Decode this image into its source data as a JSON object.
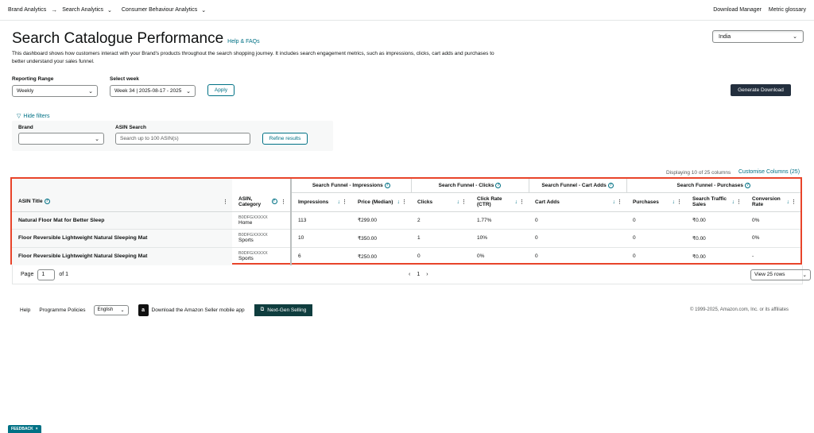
{
  "breadcrumbs": [
    "Brand Analytics",
    "Search Analytics",
    "Consumer Behaviour Analytics"
  ],
  "topnav_right": [
    "Download Manager",
    "Metric glossary"
  ],
  "page": {
    "title": "Search Catalogue Performance",
    "help_link": "Help & FAQs",
    "description": "This dashboard shows how customers interact with your Brand's products throughout the search shopping journey. It includes search engagement metrics, such as impressions, clicks, cart adds and purchases to better understand your sales funnel."
  },
  "country": "India",
  "controls": {
    "reporting_range_label": "Reporting Range",
    "reporting_range_value": "Weekly",
    "select_week_label": "Select week",
    "select_week_value": "Week 34 | 2025-08-17 - 2025",
    "apply": "Apply",
    "generate_download": "Generate Download"
  },
  "filters": {
    "hide_filters": "Hide filters",
    "brand_label": "Brand",
    "brand_value": "",
    "asin_search_label": "ASIN Search",
    "asin_search_placeholder": "Search up to 100 ASIN(s)",
    "refine": "Refine results"
  },
  "table_meta": {
    "displaying": "Displaying 10 of 25 columns",
    "customise": "Customise Columns (25)"
  },
  "table": {
    "groups": [
      "Search Funnel - Impressions",
      "Search Funnel - Clicks",
      "Search Funnel - Cart Adds",
      "Search Funnel - Purchases"
    ],
    "headers": {
      "asin_title": "ASIN Title",
      "asin_category": "ASIN, Category",
      "impressions": "Impressions",
      "price_median": "Price (Median)",
      "clicks": "Clicks",
      "ctr": "Click Rate (CTR)",
      "cart_adds": "Cart Adds",
      "purchases": "Purchases",
      "traffic_sales": "Search Traffic Sales",
      "conversion": "Conversion Rate"
    },
    "rows": [
      {
        "title": "Natural Floor Mat for Better Sleep",
        "asin": "B0DFGXXXXX",
        "category": "Home",
        "impressions": "113",
        "price": "₹299.00",
        "clicks": "2",
        "ctr": "1.77%",
        "cart_adds": "0",
        "purchases": "0",
        "sales": "₹0.00",
        "conversion": "0%"
      },
      {
        "title": "Floor Reversible Lightweight Natural Sleeping Mat",
        "asin": "B0DFGXXXXX",
        "category": "Sports",
        "impressions": "10",
        "price": "₹350.00",
        "clicks": "1",
        "ctr": "10%",
        "cart_adds": "0",
        "purchases": "0",
        "sales": "₹0.00",
        "conversion": "0%"
      },
      {
        "title": "Floor Reversible Lightweight Natural Sleeping Mat",
        "asin": "B0DFGXXXXX",
        "category": "Sports",
        "impressions": "6",
        "price": "₹250.00",
        "clicks": "0",
        "ctr": "0%",
        "cart_adds": "0",
        "purchases": "0",
        "sales": "₹0.00",
        "conversion": "-"
      }
    ]
  },
  "pager": {
    "page_label": "Page",
    "page_value": "1",
    "of_label": "of 1",
    "current": "1",
    "rows_select": "View 25 rows"
  },
  "footer": {
    "help": "Help",
    "policies": "Programme Policies",
    "language": "English",
    "mobile_app": "Download the Amazon Seller mobile app",
    "next_gen": "Next-Gen Selling",
    "copyright": "© 1999-2025, Amazon.com, Inc. or its affiliates"
  },
  "feedback": "FEEDBACK",
  "colors": {
    "link": "#007185",
    "highlight_border": "#e8442a",
    "dark_button": "#232f3e"
  }
}
